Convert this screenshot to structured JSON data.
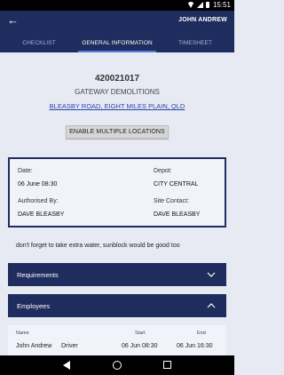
{
  "status_bar": {
    "time": "15:51"
  },
  "app_bar": {
    "back_glyph": "←",
    "user_name": "JOHN ANDREW"
  },
  "tabs": [
    {
      "label": "CHECKLIST",
      "active": false
    },
    {
      "label": "GENERAL INFORMATION",
      "active": true
    },
    {
      "label": "TIMESHEET",
      "active": false
    }
  ],
  "job": {
    "number": "420021017",
    "company": "GATEWAY DEMOLITIONS",
    "address": "BLEASBY ROAD, EIGHT MILES PLAIN, QLD"
  },
  "enable_multiple_locations_label": "ENABLE MULTIPLE LOCATIONS",
  "details": {
    "date_label": "Date:",
    "date_value": "06 June 08:30",
    "depot_label": "Depot:",
    "depot_value": "CITY CENTRAL",
    "authorised_label": "Authorised By:",
    "authorised_value": "DAVE BLEASBY",
    "contact_label": "Site Contact:",
    "contact_value": "DAVE BLEASBY"
  },
  "note": "don't forget to take extra water, sunblock would be good too",
  "sections": {
    "requirements": {
      "title": "Requirements",
      "expanded": false
    },
    "employees": {
      "title": "Employees",
      "expanded": true
    }
  },
  "employees_table": {
    "headers": {
      "name": "Name",
      "start": "Start",
      "end": "End"
    },
    "rows": [
      {
        "name": "John Andrew",
        "role": "Driver",
        "start": "06 Jun 08:30",
        "end": "06 Jun 16:30"
      }
    ]
  },
  "colors": {
    "primary": "#1e2c5e",
    "tab_indicator": "#4f7de0",
    "link": "#2544a8",
    "background": "#e8eaf3"
  }
}
